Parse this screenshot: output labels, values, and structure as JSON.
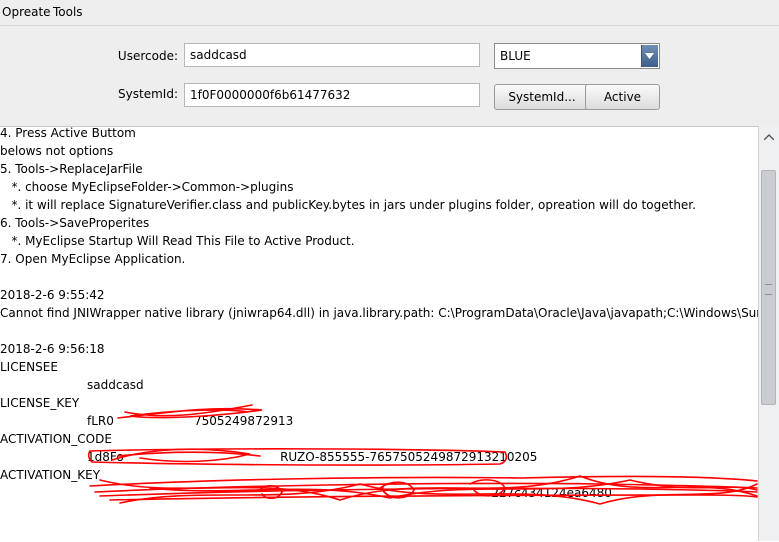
{
  "menu": [
    "Opreate",
    "Tools"
  ],
  "form": {
    "usercode_label": "Usercode:",
    "usercode_value": "saddcasd",
    "systemid_label": "SystemId:",
    "systemid_value": "1f0F0000000f6b61477632",
    "theme_selected": "BLUE",
    "systemid_button": "SystemId...",
    "active_button": "Active"
  },
  "log_lines": [
    "4. Press Active Buttom",
    "belows not options",
    "5. Tools->ReplaceJarFile",
    "   *. choose MyEclipseFolder->Common->plugins",
    "   *. it will replace SignatureVerifier.class and publicKey.bytes in jars under plugins folder, opreation will do together.",
    "6. Tools->SaveProperites",
    "   *. MyEclipse Startup Will Read This File to Active Product.",
    "7. Open MyEclipse Application.",
    "",
    "2018-2-6 9:55:42",
    "Cannot find JNIWrapper native library (jniwrap64.dll) in java.library.path: C:\\ProgramData\\Oracle\\Java\\javapath;C:\\Windows\\Sun\\Java\\bin;C:\\W",
    "",
    "2018-2-6 9:56:18",
    "LICENSEE",
    "saddcasd",
    "LICENSE_KEY",
    "fLR0                     7505249872913",
    "ACTIVATION_CODE",
    "1d8Fo                                         RUZO-855555-7657505249872913210205",
    "ACTIVATION_KEY",
    "                                                                                                          227c434124ea6480"
  ],
  "colors": {
    "panel": "#eeeeee",
    "scribble": "#ff0000",
    "combo_arrow": "#4a6a94"
  }
}
